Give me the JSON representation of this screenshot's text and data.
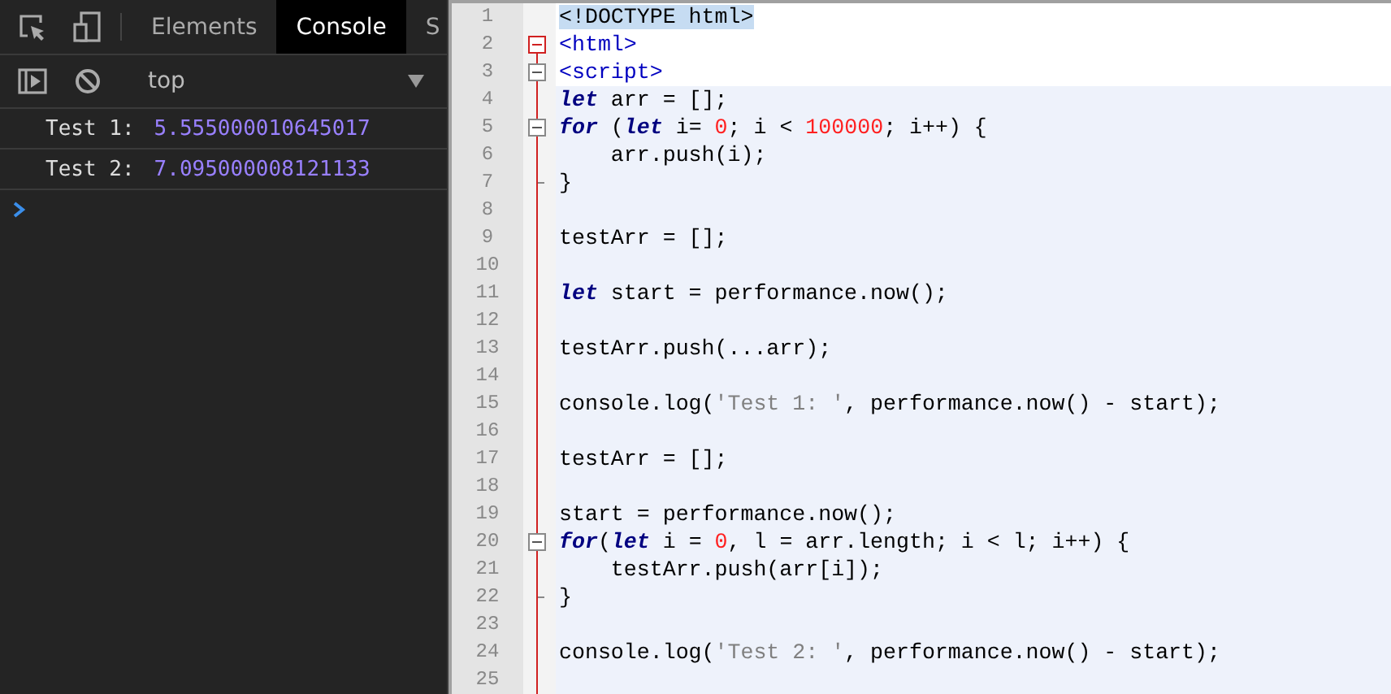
{
  "devtools": {
    "tabs": [
      {
        "label": "Elements",
        "selected": false
      },
      {
        "label": "Console",
        "selected": true
      },
      {
        "label": "S",
        "selected": false
      }
    ],
    "context": "top",
    "messages": [
      {
        "label": "Test 1:",
        "value": "5.555000010645017"
      },
      {
        "label": "Test 2:",
        "value": "7.095000008121133"
      }
    ]
  },
  "editor": {
    "lines": [
      {
        "num": "1",
        "shaded": false,
        "kind": "code",
        "tokens": [
          {
            "text": "<!DOCTYPE html>",
            "kind": "doctype"
          }
        ]
      },
      {
        "num": "2",
        "shaded": false,
        "kind": "foldable",
        "tokens": [
          {
            "text": "<html>",
            "kind": "tag"
          }
        ]
      },
      {
        "num": "3",
        "shaded": false,
        "kind": "foldable",
        "tokens": [
          {
            "text": "<script>",
            "kind": "tag"
          }
        ]
      },
      {
        "num": "4",
        "shaded": true,
        "kind": "code",
        "tokens": [
          {
            "text": "let",
            "kind": "keyword"
          },
          {
            "text": " arr = [];",
            "kind": "plain"
          }
        ]
      },
      {
        "num": "5",
        "shaded": true,
        "kind": "foldable",
        "tokens": [
          {
            "text": "for",
            "kind": "keyword"
          },
          {
            "text": " (",
            "kind": "plain"
          },
          {
            "text": "let",
            "kind": "keyword"
          },
          {
            "text": " i= ",
            "kind": "plain"
          },
          {
            "text": "0",
            "kind": "number"
          },
          {
            "text": "; i < ",
            "kind": "plain"
          },
          {
            "text": "100000",
            "kind": "number"
          },
          {
            "text": "; i++) {",
            "kind": "plain"
          }
        ]
      },
      {
        "num": "6",
        "shaded": true,
        "kind": "code",
        "tokens": [
          {
            "text": "    arr.push(i);",
            "kind": "plain"
          }
        ]
      },
      {
        "num": "7",
        "shaded": true,
        "kind": "blockend",
        "tokens": [
          {
            "text": "}",
            "kind": "plain"
          }
        ]
      },
      {
        "num": "8",
        "shaded": true,
        "kind": "code"
      },
      {
        "num": "9",
        "shaded": true,
        "kind": "code",
        "tokens": [
          {
            "text": "testArr = [];",
            "kind": "plain"
          }
        ]
      },
      {
        "num": "10",
        "shaded": true,
        "kind": "code"
      },
      {
        "num": "11",
        "shaded": true,
        "kind": "code",
        "tokens": [
          {
            "text": "let",
            "kind": "keyword"
          },
          {
            "text": " start = performance.now();",
            "kind": "plain"
          }
        ]
      },
      {
        "num": "12",
        "shaded": true,
        "kind": "code"
      },
      {
        "num": "13",
        "shaded": true,
        "kind": "code",
        "tokens": [
          {
            "text": "testArr.push(...arr);",
            "kind": "plain"
          }
        ]
      },
      {
        "num": "14",
        "shaded": true,
        "kind": "code"
      },
      {
        "num": "15",
        "shaded": true,
        "kind": "code",
        "tokens": [
          {
            "text": "console.log(",
            "kind": "plain"
          },
          {
            "text": "'Test 1: '",
            "kind": "string"
          },
          {
            "text": ", performance.now() - start);",
            "kind": "plain"
          }
        ]
      },
      {
        "num": "16",
        "shaded": true,
        "kind": "code"
      },
      {
        "num": "17",
        "shaded": true,
        "kind": "code",
        "tokens": [
          {
            "text": "testArr = [];",
            "kind": "plain"
          }
        ]
      },
      {
        "num": "18",
        "shaded": true,
        "kind": "code"
      },
      {
        "num": "19",
        "shaded": true,
        "kind": "code",
        "tokens": [
          {
            "text": "start = performance.now();",
            "kind": "plain"
          }
        ]
      },
      {
        "num": "20",
        "shaded": true,
        "kind": "foldable",
        "tokens": [
          {
            "text": "for",
            "kind": "keyword"
          },
          {
            "text": "(",
            "kind": "plain"
          },
          {
            "text": "let",
            "kind": "keyword"
          },
          {
            "text": " i = ",
            "kind": "plain"
          },
          {
            "text": "0",
            "kind": "number"
          },
          {
            "text": ", l = arr.length; i < l; i++) {",
            "kind": "plain"
          }
        ]
      },
      {
        "num": "21",
        "shaded": true,
        "kind": "code",
        "tokens": [
          {
            "text": "    testArr.push(arr[i]);",
            "kind": "plain"
          }
        ]
      },
      {
        "num": "22",
        "shaded": true,
        "kind": "blockend",
        "tokens": [
          {
            "text": "}",
            "kind": "plain"
          }
        ]
      },
      {
        "num": "23",
        "shaded": true,
        "kind": "code"
      },
      {
        "num": "24",
        "shaded": true,
        "kind": "code",
        "tokens": [
          {
            "text": "console.log(",
            "kind": "plain"
          },
          {
            "text": "'Test 2: '",
            "kind": "string"
          },
          {
            "text": ", performance.now() - start);",
            "kind": "plain"
          }
        ]
      },
      {
        "num": "25",
        "shaded": true,
        "kind": "code"
      }
    ]
  }
}
